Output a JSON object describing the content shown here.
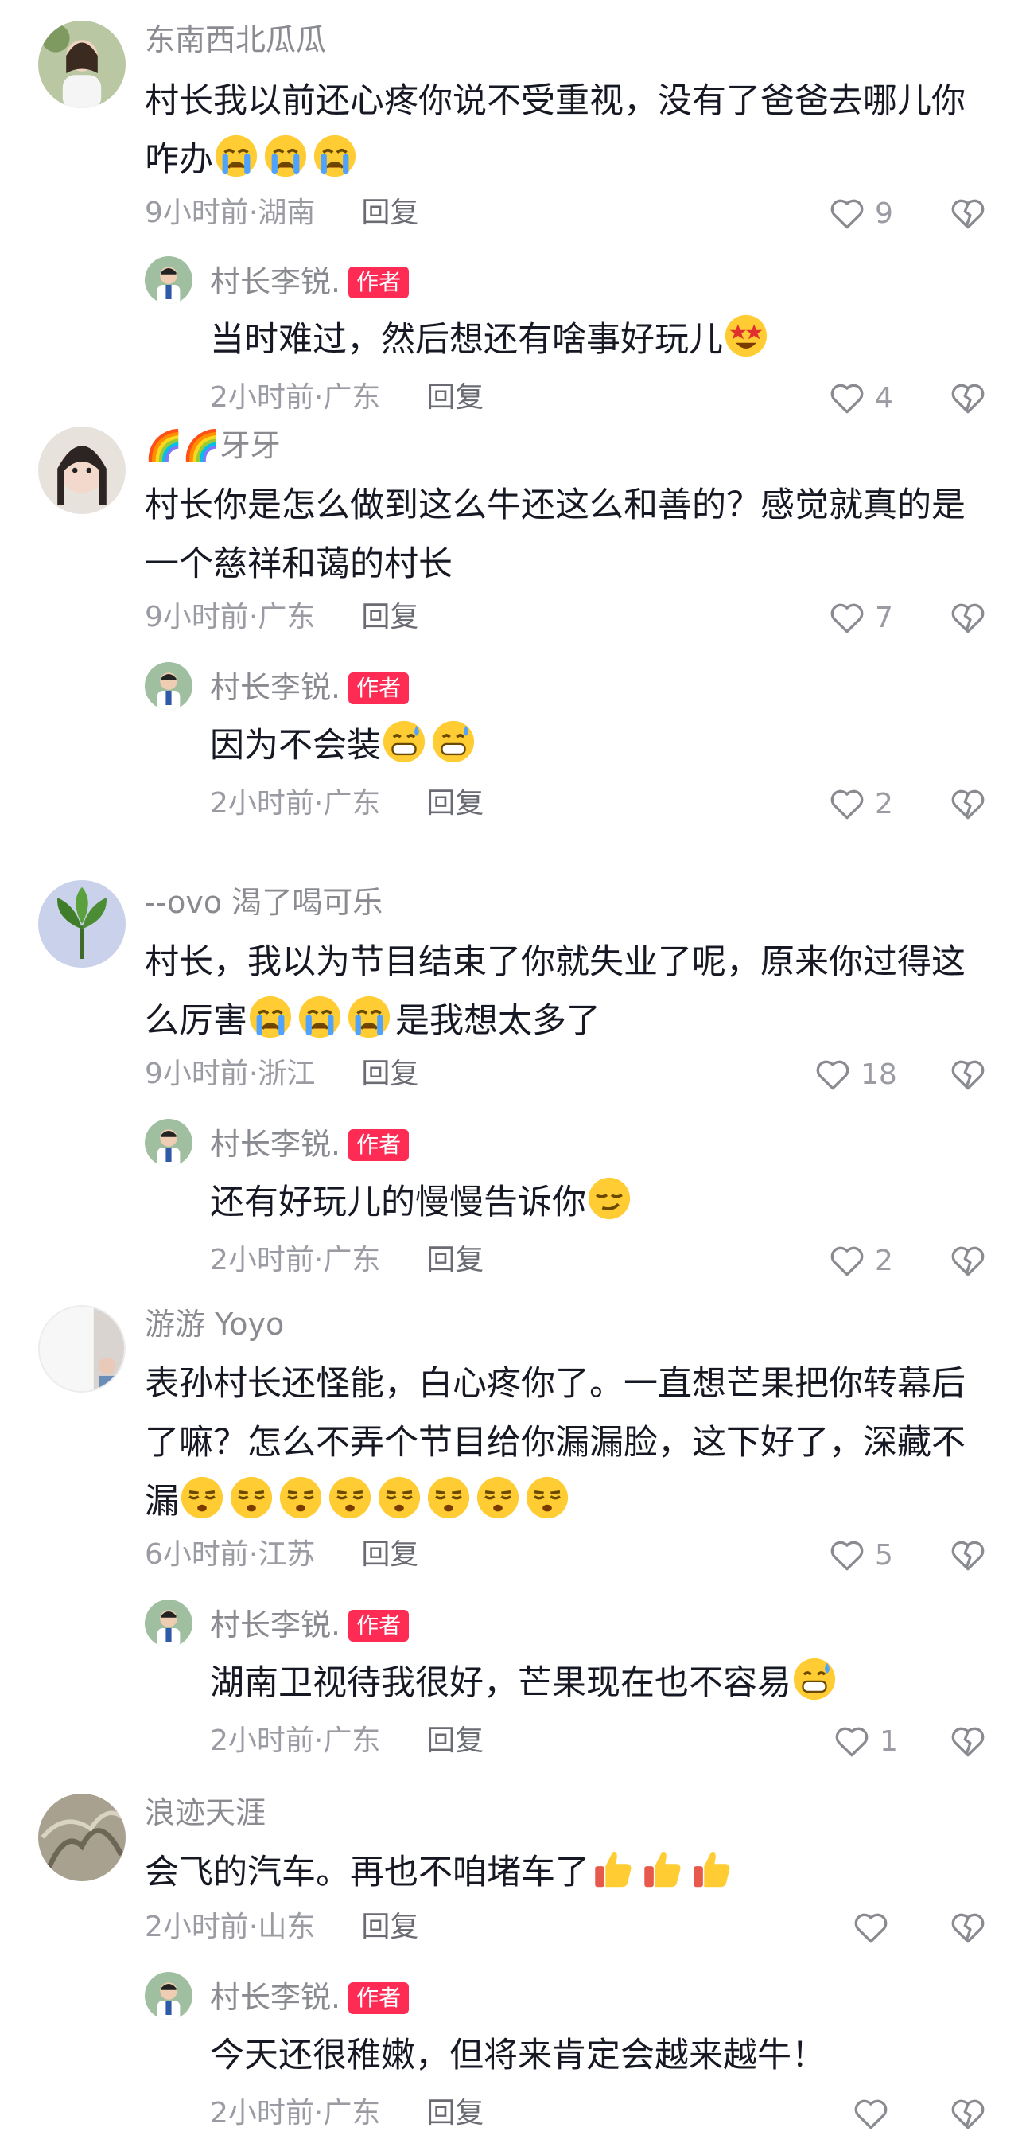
{
  "comments": [
    {
      "name": "东南西北瓜瓜",
      "text": "村长我以前还心疼你说不受重视，没有了爸爸去哪儿你咋办",
      "emoji_icons": [
        "crying-emoji",
        "crying-emoji",
        "crying-emoji"
      ],
      "time": "9小时前·湖南",
      "reply_label": "回复",
      "likes": "9",
      "reply": {
        "name": "村长李锐.",
        "badge": "作者",
        "text": "当时难过，然后想还有啥事好玩儿",
        "emoji_icons": [
          "star-struck-emoji"
        ],
        "time": "2小时前·广东",
        "reply_label": "回复",
        "likes": "4"
      }
    },
    {
      "name": "🌈🌈牙牙",
      "text": "村长你是怎么做到这么牛还这么和善的？感觉就真的是一个慈祥和蔼的村长",
      "emoji_icons": [],
      "time": "9小时前·广东",
      "reply_label": "回复",
      "likes": "7",
      "reply": {
        "name": "村长李锐.",
        "badge": "作者",
        "text": "因为不会装",
        "emoji_icons": [
          "grin-sweat-emoji",
          "grin-sweat-emoji"
        ],
        "time": "2小时前·广东",
        "reply_label": "回复",
        "likes": "2"
      }
    },
    {
      "name": "--ovo 渴了喝可乐",
      "text": "村长，我以为节目结束了你就失业了呢，原来你过得这么厉害",
      "text_after_emoji": "是我想太多了",
      "emoji_icons": [
        "crying-emoji",
        "crying-emoji",
        "crying-emoji"
      ],
      "time": "9小时前·浙江",
      "reply_label": "回复",
      "likes": "18",
      "reply": {
        "name": "村长李锐.",
        "badge": "作者",
        "text": "还有好玩儿的慢慢告诉你",
        "emoji_icons": [
          "smirk-emoji"
        ],
        "time": "2小时前·广东",
        "reply_label": "回复",
        "likes": "2"
      }
    },
    {
      "name": "游游 Yoyo",
      "text": "表孙村长还怪能，白心疼你了。一直想芒果把你转幕后了嘛？怎么不弄个节目给你漏漏脸，这下好了，深藏不漏",
      "emoji_icons": [
        "smirk-face-emoji",
        "smirk-face-emoji",
        "smirk-face-emoji",
        "smirk-face-emoji",
        "smirk-face-emoji",
        "smirk-face-emoji",
        "smirk-face-emoji",
        "smirk-face-emoji"
      ],
      "time": "6小时前·江苏",
      "reply_label": "回复",
      "likes": "5",
      "reply": {
        "name": "村长李锐.",
        "badge": "作者",
        "text": "湖南卫视待我很好，芒果现在也不容易",
        "emoji_icons": [
          "grin-sweat-emoji"
        ],
        "time": "2小时前·广东",
        "reply_label": "回复",
        "likes": "1"
      }
    },
    {
      "name": "浪迹天涯",
      "text": "会飞的汽车。再也不咱堵车了",
      "emoji_icons": [
        "thumbs-up-emoji",
        "thumbs-up-emoji",
        "thumbs-up-emoji"
      ],
      "time": "2小时前·山东",
      "reply_label": "回复",
      "likes": "",
      "reply": {
        "name": "村长李锐.",
        "badge": "作者",
        "text": "今天还很稚嫩，但将来肯定会越来越牛！",
        "emoji_icons": [],
        "time": "2小时前·广东",
        "reply_label": "回复",
        "likes": ""
      }
    }
  ]
}
